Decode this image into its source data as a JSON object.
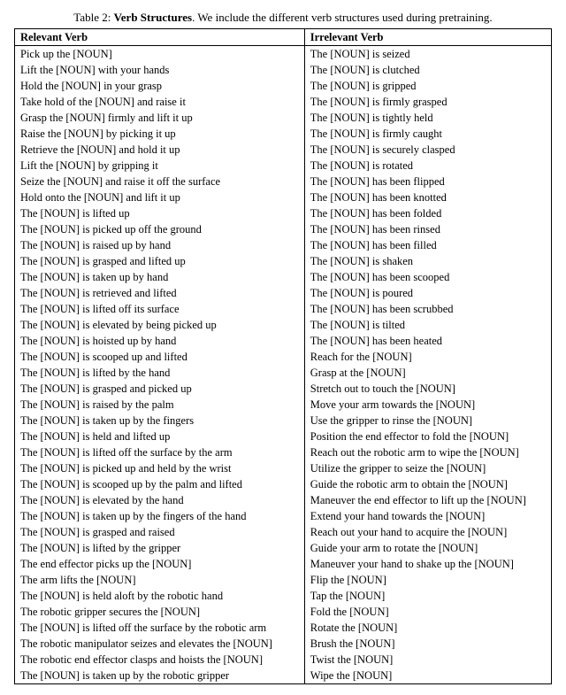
{
  "caption": {
    "label": "Table 2:",
    "title": "Verb Structures",
    "desc": ". We include the different verb structures used during pretraining."
  },
  "headers": {
    "col1": "Relevant Verb",
    "col2": "Irrelevant Verb"
  },
  "rows": [
    {
      "r": "Pick up the [NOUN]",
      "i": "The [NOUN] is seized"
    },
    {
      "r": "Lift the [NOUN] with your hands",
      "i": "The [NOUN] is clutched"
    },
    {
      "r": "Hold the [NOUN] in your grasp",
      "i": "The [NOUN] is gripped"
    },
    {
      "r": "Take hold of the [NOUN] and raise it",
      "i": "The [NOUN] is firmly grasped"
    },
    {
      "r": "Grasp the [NOUN] firmly and lift it up",
      "i": "The [NOUN] is tightly held"
    },
    {
      "r": "Raise the [NOUN] by picking it up",
      "i": "The [NOUN] is firmly caught"
    },
    {
      "r": "Retrieve the [NOUN] and hold it up",
      "i": "The [NOUN] is securely clasped"
    },
    {
      "r": "Lift the [NOUN] by gripping it",
      "i": "The [NOUN] is rotated"
    },
    {
      "r": "Seize the [NOUN] and raise it off the surface",
      "i": "The [NOUN] has been flipped"
    },
    {
      "r": "Hold onto the [NOUN] and lift it up",
      "i": "The [NOUN] has been knotted"
    },
    {
      "r": "The [NOUN] is lifted up",
      "i": "The [NOUN] has been folded"
    },
    {
      "r": "The [NOUN] is picked up off the ground",
      "i": "The [NOUN] has been rinsed"
    },
    {
      "r": "The [NOUN] is raised up by hand",
      "i": "The [NOUN] has been filled"
    },
    {
      "r": "The [NOUN] is grasped and lifted up",
      "i": "The [NOUN] is shaken"
    },
    {
      "r": "The [NOUN] is taken up by hand",
      "i": "The [NOUN] has been scooped"
    },
    {
      "r": "The [NOUN] is retrieved and lifted",
      "i": "The [NOUN] is poured"
    },
    {
      "r": "The [NOUN] is lifted off its surface",
      "i": "The [NOUN] has been scrubbed"
    },
    {
      "r": "The [NOUN] is elevated by being picked up",
      "i": "The [NOUN] is tilted"
    },
    {
      "r": "The [NOUN] is hoisted up by hand",
      "i": "The [NOUN] has been heated"
    },
    {
      "r": "The [NOUN] is scooped up and lifted",
      "i": "Reach for the [NOUN]"
    },
    {
      "r": "The [NOUN] is lifted by the hand",
      "i": "Grasp at the [NOUN]"
    },
    {
      "r": "The [NOUN] is grasped and picked up",
      "i": "Stretch out to touch the [NOUN]"
    },
    {
      "r": "The [NOUN] is raised by the palm",
      "i": "Move your arm towards the [NOUN]"
    },
    {
      "r": "The [NOUN] is taken up by the fingers",
      "i": "Use the gripper to rinse the [NOUN]"
    },
    {
      "r": "The [NOUN] is held and lifted up",
      "i": "Position the end effector to fold the [NOUN]"
    },
    {
      "r": "The [NOUN] is lifted off the surface by the arm",
      "i": "Reach out the robotic arm to wipe the [NOUN]"
    },
    {
      "r": "The [NOUN] is picked up and held by the wrist",
      "i": "Utilize the gripper to seize the [NOUN]"
    },
    {
      "r": "The [NOUN] is scooped up by the palm and lifted",
      "i": "Guide the robotic arm to obtain the [NOUN]"
    },
    {
      "r": "The [NOUN] is elevated by the hand",
      "i": "Maneuver the end effector to lift up the [NOUN]"
    },
    {
      "r": "The [NOUN] is taken up by the fingers of the hand",
      "i": "Extend your hand towards the [NOUN]"
    },
    {
      "r": "The [NOUN] is grasped and raised",
      "i": "Reach out your hand to acquire the [NOUN]"
    },
    {
      "r": "The [NOUN] is lifted by the gripper",
      "i": "Guide your arm to rotate the [NOUN]"
    },
    {
      "r": "The end effector picks up the [NOUN]",
      "i": "Maneuver your hand to shake up the [NOUN]"
    },
    {
      "r": "The arm lifts the [NOUN]",
      "i": "Flip the [NOUN]"
    },
    {
      "r": "The [NOUN] is held aloft by the robotic hand",
      "i": "Tap the [NOUN]"
    },
    {
      "r": "The robotic gripper secures the [NOUN]",
      "i": "Fold the [NOUN]"
    },
    {
      "r": "The [NOUN] is lifted off the surface by the robotic arm",
      "i": "Rotate the [NOUN]"
    },
    {
      "r": "The robotic manipulator seizes and elevates the [NOUN]",
      "i": "Brush the [NOUN]"
    },
    {
      "r": "The robotic end effector clasps and hoists the [NOUN]",
      "i": "Twist the [NOUN]"
    },
    {
      "r": "The [NOUN] is taken up by the robotic gripper",
      "i": "Wipe the [NOUN]"
    }
  ]
}
